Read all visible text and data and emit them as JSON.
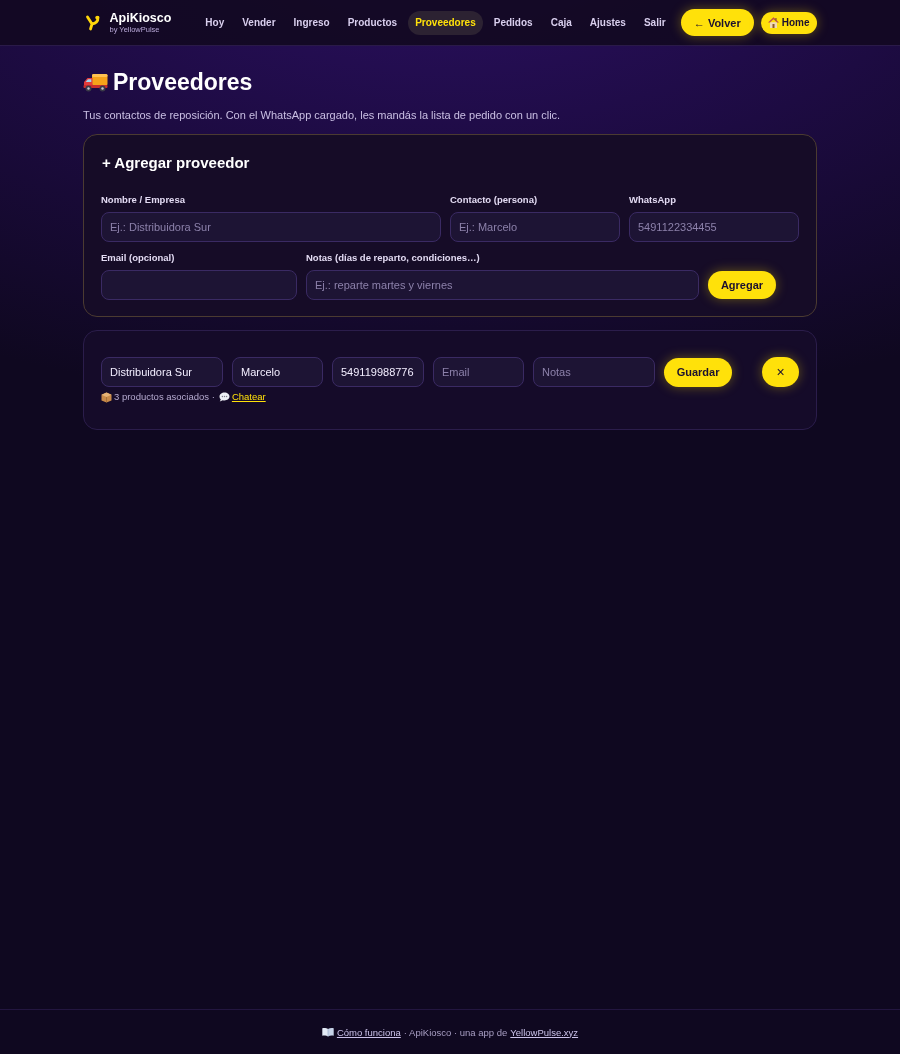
{
  "nav": {
    "brand": {
      "name": "ApiKiosco",
      "tagline": "by YellowPulse"
    },
    "items": [
      {
        "label": "Hoy",
        "selected": false
      },
      {
        "label": "Vender",
        "selected": false
      },
      {
        "label": "Ingreso",
        "selected": false
      },
      {
        "label": "Productos",
        "selected": false
      },
      {
        "label": "Proveedores",
        "selected": true
      },
      {
        "label": "Pedidos",
        "selected": false
      },
      {
        "label": "Caja",
        "selected": false
      },
      {
        "label": "Ajustes",
        "selected": false
      },
      {
        "label": "Salir",
        "selected": false
      }
    ],
    "back_button": "← Volver",
    "home_button": "Home"
  },
  "page": {
    "title": "Proveedores",
    "subtitle": "Tus contactos de reposición. Con el WhatsApp cargado, les mandás la lista de pedido con un clic."
  },
  "add_form": {
    "title": "+ Agregar proveedor",
    "name": {
      "label": "Nombre / Empresa",
      "placeholder": "Ej.: Distribuidora Sur"
    },
    "contact": {
      "label": "Contacto (persona)",
      "placeholder": "Ej.: Marcelo"
    },
    "whatsapp": {
      "label": "WhatsApp",
      "placeholder": "5491122334455"
    },
    "email": {
      "label": "Email (opcional)"
    },
    "notes": {
      "label": "Notas (días de reparto, condiciones…)",
      "placeholder": "Ej.: reparte martes y viernes"
    },
    "button": "Agregar"
  },
  "suppliers": [
    {
      "name": {
        "value": "Distribuidora Sur"
      },
      "contact": {
        "value": "Marcelo"
      },
      "whatsapp": {
        "value": "549119988776"
      },
      "email": {
        "placeholder": "Email"
      },
      "notes": {
        "placeholder": "Notas"
      },
      "save_button": "Guardar",
      "delete_button": "×",
      "products": "3 productos asociados ·",
      "chat_link": "Chatear"
    }
  ],
  "footer": {
    "guide_link": "Cómo funciona",
    "text": "· ApiKiosco · una app de",
    "site_link": "YellowPulse.xyz"
  }
}
